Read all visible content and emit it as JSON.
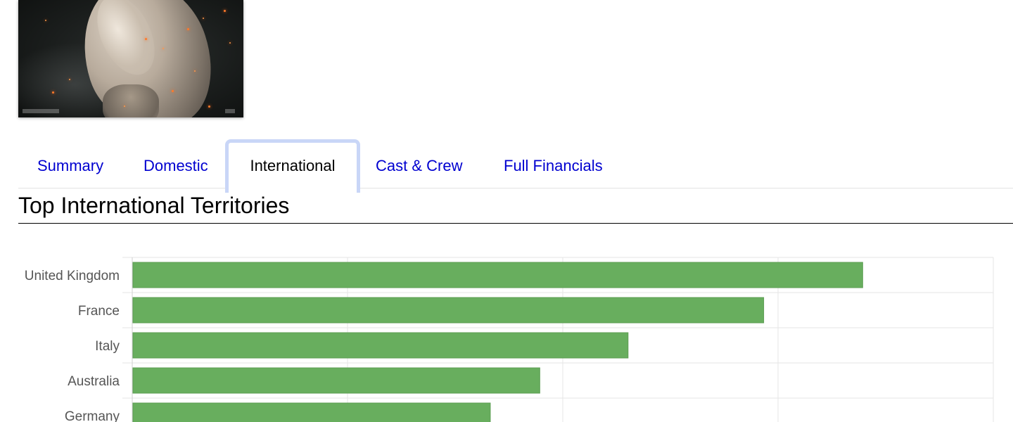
{
  "tabs": [
    {
      "label": "Summary"
    },
    {
      "label": "Domestic"
    },
    {
      "label": "International",
      "active": true
    },
    {
      "label": "Cast & Crew"
    },
    {
      "label": "Full Financials"
    }
  ],
  "section_title": "Top International Territories",
  "colors": {
    "tab_link": "#0000d0",
    "tab_active_border": "#c9d6f7",
    "bar": "#68ae5e"
  },
  "chart_data": {
    "type": "bar",
    "orientation": "horizontal",
    "categories": [
      "United Kingdom",
      "France",
      "Italy",
      "Australia",
      "Germany"
    ],
    "values": [
      33.9,
      29.3,
      23.0,
      18.9,
      16.6
    ],
    "xlim": [
      0,
      40
    ],
    "grid": true,
    "title": "",
    "xlabel": "",
    "ylabel": ""
  }
}
